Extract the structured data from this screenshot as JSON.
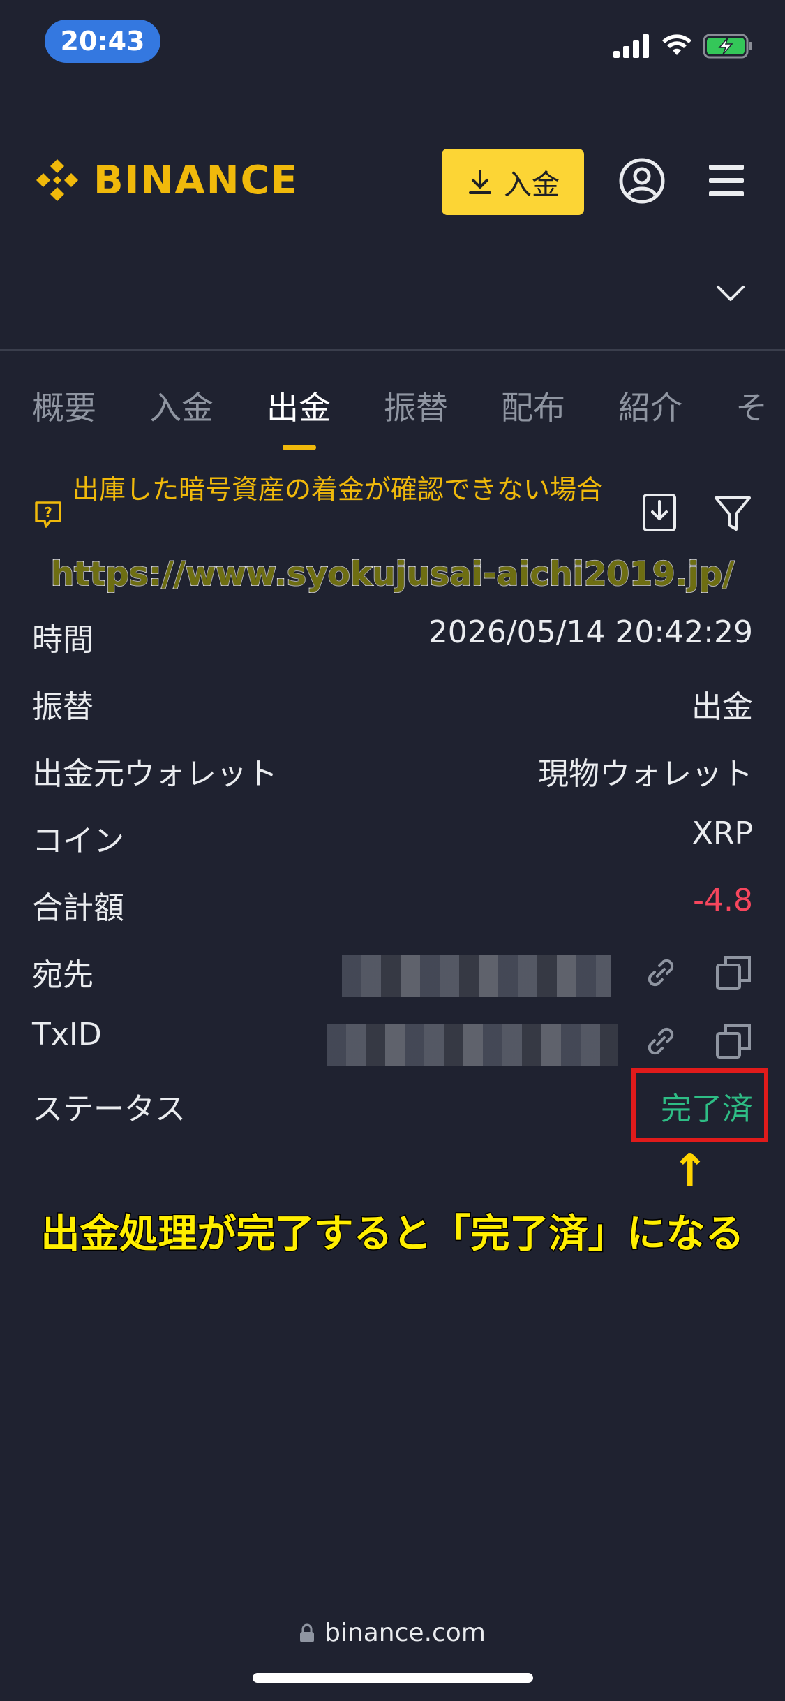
{
  "status_bar": {
    "time": "20:43"
  },
  "header": {
    "logo_text": "BINANCE",
    "deposit_label": "入金"
  },
  "tabs": [
    {
      "label": "概要",
      "active": false
    },
    {
      "label": "入金",
      "active": false
    },
    {
      "label": "出金",
      "active": true
    },
    {
      "label": "振替",
      "active": false
    },
    {
      "label": "配布",
      "active": false
    },
    {
      "label": "紹介",
      "active": false
    },
    {
      "label": "そ",
      "active": false
    }
  ],
  "notice": {
    "text": "出庫した暗号資産の着金が確認できない場合"
  },
  "overlay_url": "https://www.syokujusai-aichi2019.jp/",
  "details": {
    "time": {
      "label": "時間",
      "value": "2026/05/14 20:42:29"
    },
    "transfer": {
      "label": "振替",
      "value": "出金"
    },
    "from_wallet": {
      "label": "出金元ウォレット",
      "value": "現物ウォレット"
    },
    "coin": {
      "label": "コイン",
      "value": "XRP"
    },
    "total": {
      "label": "合計額",
      "value": "-4.8"
    },
    "destination": {
      "label": "宛先"
    },
    "txid": {
      "label": "TxID"
    },
    "status": {
      "label": "ステータス",
      "value": "完了済"
    }
  },
  "annotation": {
    "arrow": "↑",
    "caption": "出金処理が完了すると「完了済」になる"
  },
  "footer": {
    "domain": "binance.com"
  },
  "colors": {
    "brand": "#f0b90b",
    "negative": "#f6465d",
    "success": "#2ebd85",
    "background": "#1f2230"
  }
}
